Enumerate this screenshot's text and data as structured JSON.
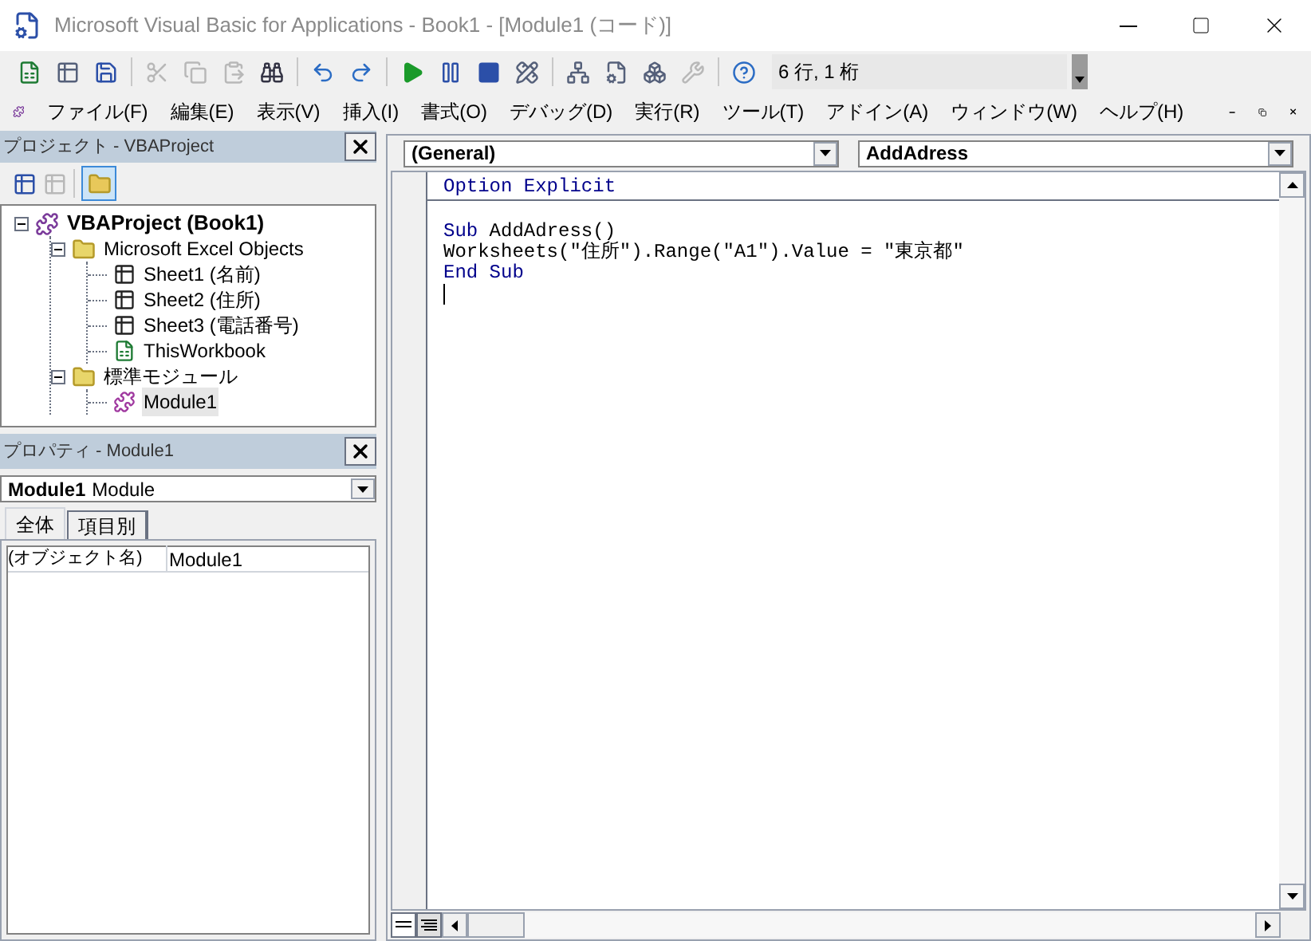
{
  "window": {
    "title": "Microsoft Visual Basic for Applications - Book1 - [Module1 (コード)]"
  },
  "toolbar": {
    "buttons": [
      {
        "kind": "excel",
        "disabled": false
      },
      {
        "kind": "insert",
        "disabled": false
      },
      {
        "kind": "save",
        "disabled": false
      },
      {
        "kind": "cut",
        "disabled": true
      },
      {
        "kind": "copy",
        "disabled": true
      },
      {
        "kind": "paste",
        "disabled": true
      },
      {
        "kind": "find",
        "disabled": false
      },
      {
        "kind": "undo",
        "disabled": false
      },
      {
        "kind": "redo",
        "disabled": false
      },
      {
        "kind": "run",
        "disabled": false
      },
      {
        "kind": "pause",
        "disabled": false
      },
      {
        "kind": "stop",
        "disabled": false
      },
      {
        "kind": "design",
        "disabled": false
      },
      {
        "kind": "project",
        "disabled": false
      },
      {
        "kind": "properties",
        "disabled": false
      },
      {
        "kind": "browser",
        "disabled": false
      },
      {
        "kind": "toolbox",
        "disabled": true
      },
      {
        "kind": "help",
        "disabled": false
      }
    ],
    "position": "6 行, 1 桁"
  },
  "menu": [
    "ファイル(F)",
    "編集(E)",
    "表示(V)",
    "挿入(I)",
    "書式(O)",
    "デバッグ(D)",
    "実行(R)",
    "ツール(T)",
    "アドイン(A)",
    "ウィンドウ(W)",
    "ヘルプ(H)"
  ],
  "project": {
    "title": "プロジェクト - VBAProject",
    "tree": [
      {
        "label": "VBAProject (Book1)",
        "kind": "project",
        "expanded": true,
        "selected": false,
        "children": [
          {
            "label": "Microsoft Excel Objects",
            "kind": "folder",
            "expanded": true,
            "selected": false,
            "children": [
              {
                "label": "Sheet1 (名前)",
                "kind": "sheet",
                "selected": false
              },
              {
                "label": "Sheet2 (住所)",
                "kind": "sheet",
                "selected": false
              },
              {
                "label": "Sheet3 (電話番号)",
                "kind": "sheet",
                "selected": false
              },
              {
                "label": "ThisWorkbook",
                "kind": "workbook",
                "selected": false
              }
            ]
          },
          {
            "label": "標準モジュール",
            "kind": "folder",
            "expanded": true,
            "selected": false,
            "children": [
              {
                "label": "Module1",
                "kind": "module",
                "selected": true
              }
            ]
          }
        ]
      }
    ]
  },
  "properties": {
    "title": "プロパティ - Module1",
    "object_name": "Module1",
    "object_type": "Module",
    "tabs": [
      {
        "label": "全体",
        "selected": true
      },
      {
        "label": "項目別",
        "selected": false
      }
    ],
    "rows": [
      {
        "name": "(オブジェクト名)",
        "value": "Module1"
      }
    ]
  },
  "code": {
    "object": "(General)",
    "procedure": "AddAdress",
    "declarations": [
      [
        {
          "text": "Option Explicit",
          "kind": "keyword"
        }
      ]
    ],
    "lines": [
      [
        {
          "text": "Sub",
          "kind": "keyword"
        },
        {
          "text": " AddAdress()",
          "kind": "plain"
        }
      ],
      [
        {
          "text": "Worksheets(\"住所\").Range(\"A1\").Value = \"東京都\"",
          "kind": "plain"
        }
      ],
      [
        {
          "text": "End Sub",
          "kind": "keyword"
        }
      ]
    ]
  }
}
